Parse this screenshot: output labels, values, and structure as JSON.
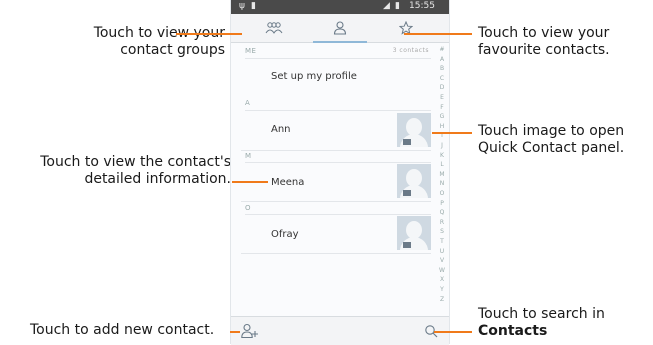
{
  "callouts": {
    "groups": [
      "Touch to view your",
      "contact groups"
    ],
    "favourites": [
      "Touch to view your",
      "favourite contacts."
    ],
    "detail": [
      "Touch to view the contact's",
      "detailed information."
    ],
    "quick": [
      "Touch image to open",
      "Quick Contact panel."
    ],
    "add": "Touch to add new contact.",
    "search_line1": "Touch to search in",
    "search_line2": "Contacts"
  },
  "status": {
    "time": "15:55"
  },
  "list": {
    "section_me": "ME",
    "me_count": "3 contacts",
    "setup_profile": "Set up my profile",
    "sections": [
      "A",
      "M",
      "O"
    ],
    "contacts": [
      "Ann",
      "Meena",
      "Ofray"
    ]
  },
  "alphabet": [
    "#",
    "A",
    "B",
    "C",
    "D",
    "E",
    "F",
    "G",
    "H",
    "I",
    "J",
    "K",
    "L",
    "M",
    "N",
    "O",
    "P",
    "Q",
    "R",
    "S",
    "T",
    "U",
    "V",
    "W",
    "X",
    "Y",
    "Z"
  ],
  "icons": {
    "groups": "people-group-icon",
    "contacts": "person-icon",
    "favourites": "star-icon",
    "add": "add-contact-icon",
    "search": "search-icon"
  },
  "colors": {
    "callout_line": "#f07a1a",
    "tab_indicator": "#8fb8d8"
  }
}
